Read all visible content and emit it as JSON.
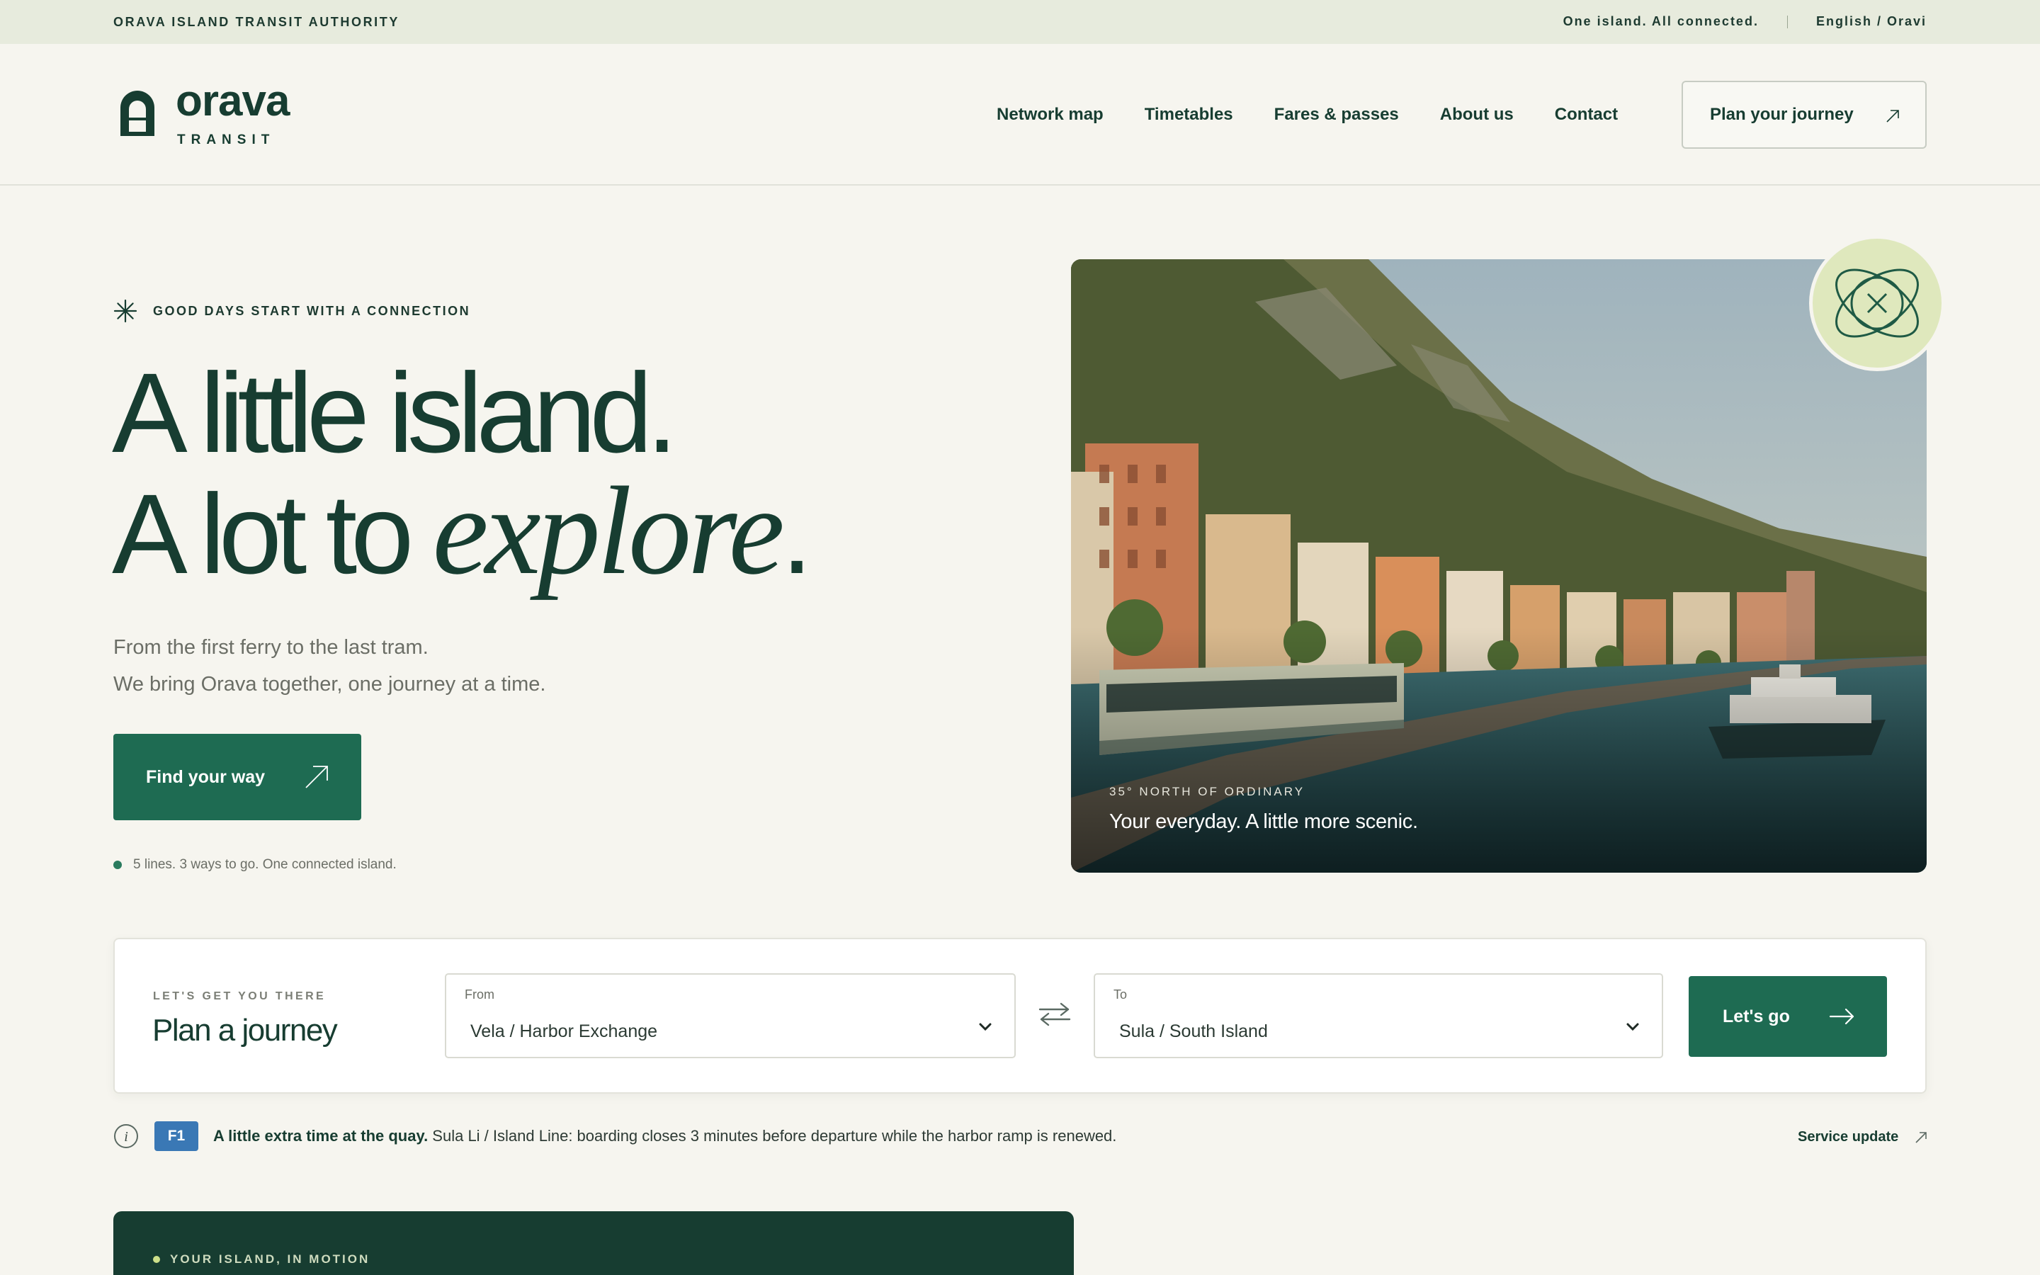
{
  "utility": {
    "authority": "ORAVA ISLAND TRANSIT AUTHORITY",
    "tagline": "One island. All connected.",
    "language": "English / Oravi"
  },
  "brand": {
    "name": "orava",
    "sub": "TRANSIT"
  },
  "nav": {
    "items": [
      "Network map",
      "Timetables",
      "Fares & passes",
      "About us",
      "Contact"
    ],
    "cta": "Plan your journey"
  },
  "hero": {
    "eyebrow": "GOOD DAYS START WITH A CONNECTION",
    "line1": "A little island.",
    "line2_plain": "A lot to ",
    "line2_italic": "explore",
    "line2_end": ".",
    "sub1": "From the first ferry to the last tram.",
    "sub2": "We bring Orava together, one journey at a time.",
    "cta": "Find your way",
    "meta": "5 lines. 3 ways to go. One connected island.",
    "photo_kicker": "35° NORTH OF ORDINARY",
    "photo_caption": "Your everyday. A little more scenic."
  },
  "planner": {
    "kicker": "LET'S GET YOU THERE",
    "title": "Plan a journey",
    "from_label": "From",
    "from_value": "Vela / Harbor Exchange",
    "to_label": "To",
    "to_value": "Sula / South Island",
    "go": "Let's go"
  },
  "notice": {
    "tag": "F1",
    "bold": "A little extra time at the quay.",
    "text": " Sula Li / Island Line: boarding closes 3 minutes before departure while the harbor ramp is renewed.",
    "link": "Service update"
  },
  "motion": {
    "kicker": "YOUR ISLAND, IN MOTION"
  },
  "colors": {
    "primary": "#1e6b52",
    "ink": "#173d31",
    "background": "#f6f5ef",
    "alert": "#3a78b5",
    "badge": "#dfe8bd"
  }
}
